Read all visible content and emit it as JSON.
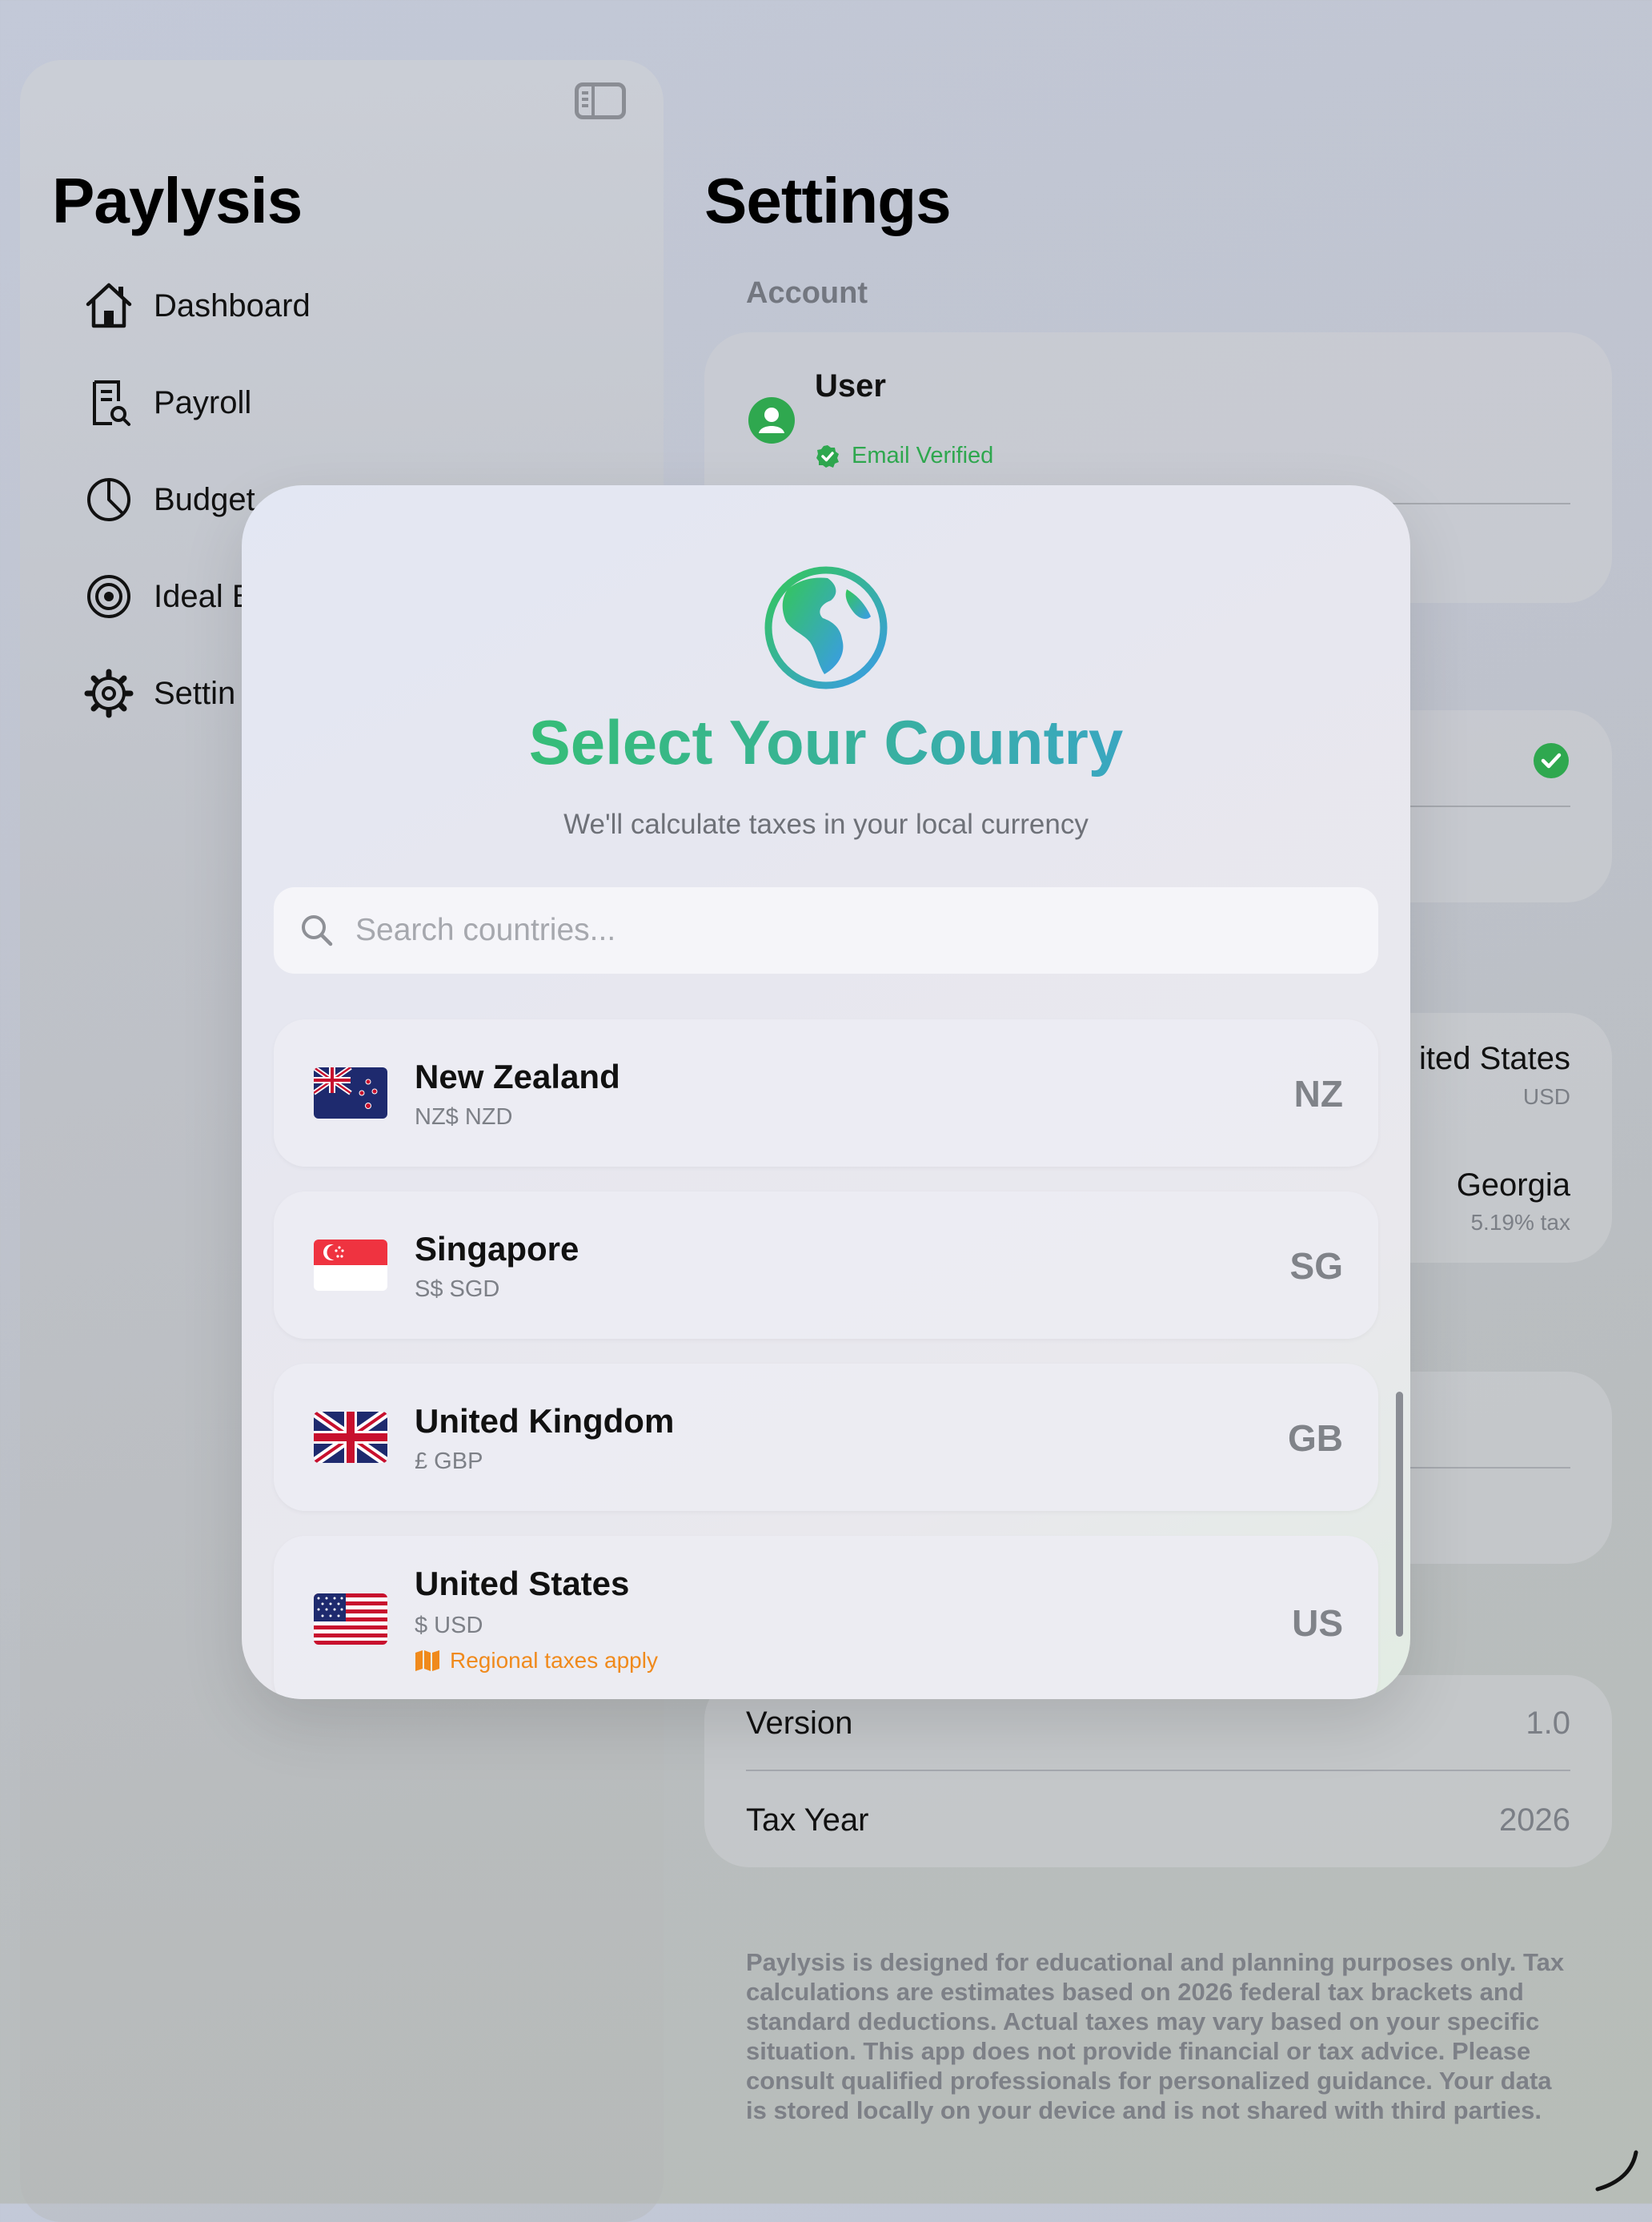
{
  "sidebar": {
    "app_title": "Paylysis",
    "items": [
      {
        "label": "Dashboard",
        "icon": "house-icon"
      },
      {
        "label": "Payroll",
        "icon": "receipt-search-icon"
      },
      {
        "label": "Budget",
        "icon": "pie-chart-icon"
      },
      {
        "label": "Ideal B",
        "icon": "target-icon"
      },
      {
        "label": "Settin",
        "icon": "gear-icon"
      }
    ]
  },
  "settings": {
    "title": "Settings",
    "account_label": "Account",
    "user_name": "User",
    "email_status": "Email Verified",
    "country_value": "ited States",
    "country_currency": "USD",
    "state_value": "Georgia",
    "state_tax": "5.19% tax",
    "version_label": "Version",
    "version_value": "1.0",
    "tax_year_label": "Tax Year",
    "tax_year_value": "2026",
    "disclaimer": "Paylysis is designed for educational and planning purposes only. Tax calculations are estimates based on 2026 federal tax brackets and standard deductions. Actual taxes may vary based on your specific situation. This app does not provide financial or tax advice. Please consult qualified professionals for personalized guidance. Your data is stored locally on your device and is not shared with third parties."
  },
  "country_sheet": {
    "title": "Select Your Country",
    "subtitle": "We'll calculate taxes in your local currency",
    "search_placeholder": "Search countries...",
    "countries": [
      {
        "name": "New Zealand",
        "currency": "NZ$ NZD",
        "code": "NZ"
      },
      {
        "name": "Singapore",
        "currency": "S$ SGD",
        "code": "SG"
      },
      {
        "name": "United Kingdom",
        "currency": "£ GBP",
        "code": "GB"
      },
      {
        "name": "United States",
        "currency": "$ USD",
        "code": "US",
        "note": "Regional taxes apply"
      }
    ]
  },
  "colors": {
    "accent_green": "#34c759",
    "accent_blue": "#3a9be8",
    "warning_orange": "#f08a1c",
    "verified_green": "#2fa84f"
  }
}
